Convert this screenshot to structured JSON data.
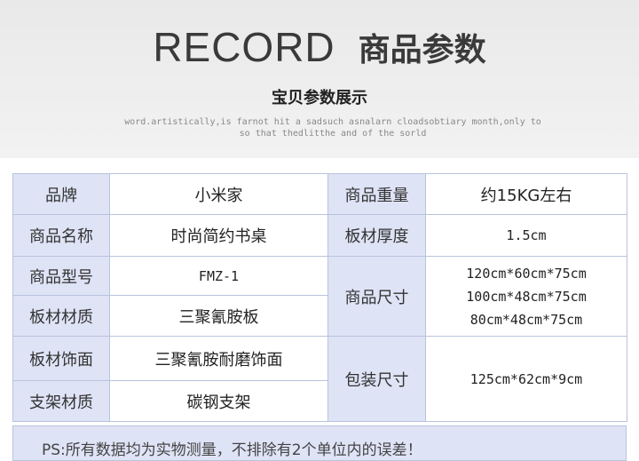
{
  "header": {
    "title_en": "RECORD",
    "title_cn": "商品参数",
    "subtitle": "宝贝参数展示",
    "tagline_line1": "word.artistically,is farnot hit a sadsuch asnalarn cloadsobtiary month,only to",
    "tagline_line2": "so that thedlitthe and of the sorld"
  },
  "specs": {
    "brand_label": "品牌",
    "brand_value": "小米家",
    "weight_label": "商品重量",
    "weight_value": "约15KG左右",
    "name_label": "商品名称",
    "name_value": "时尚简约书桌",
    "thickness_label": "板材厚度",
    "thickness_value": "1.5cm",
    "model_label": "商品型号",
    "model_value": "FMZ-1",
    "size_label": "商品尺寸",
    "size_values": [
      "120cm*60cm*75cm",
      "100cm*48cm*75cm",
      "80cm*48cm*75cm"
    ],
    "material_label": "板材材质",
    "material_value": "三聚氰胺板",
    "surface_label": "板材饰面",
    "surface_value": "三聚氰胺耐磨饰面",
    "package_label": "包装尺寸",
    "package_value": "125cm*62cm*9cm",
    "frame_label": "支架材质",
    "frame_value": "碳钢支架"
  },
  "note": "PS:所有数据均为实物测量，不排除有2个单位内的误差！",
  "colors": {
    "label_bg": "#dfe3f6",
    "border": "#b8c3dc",
    "header_bg": "#ececec"
  }
}
